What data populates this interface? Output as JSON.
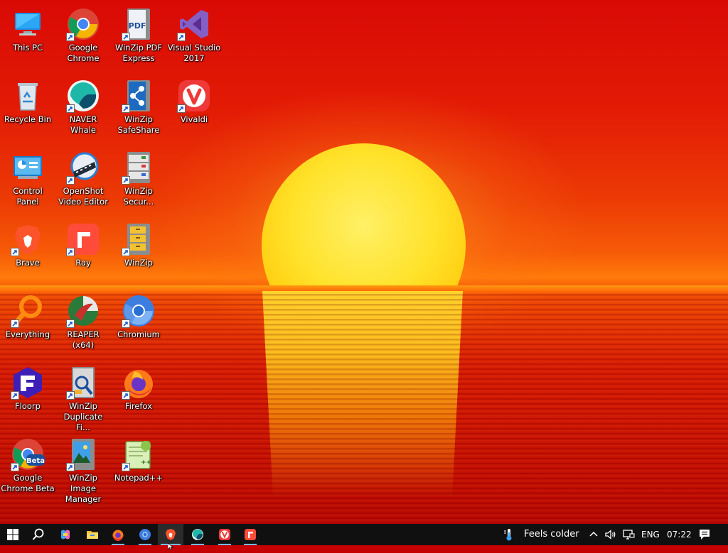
{
  "desktop_icons": [
    {
      "label": "This PC",
      "icon": "this-pc-icon"
    },
    {
      "label": "Google Chrome",
      "icon": "chrome-icon"
    },
    {
      "label": "WinZip PDF Express",
      "icon": "winzip-pdf-icon"
    },
    {
      "label": "Visual Studio 2017",
      "icon": "visual-studio-icon"
    },
    {
      "label": "Recycle Bin",
      "icon": "recycle-bin-icon"
    },
    {
      "label": "NAVER Whale",
      "icon": "naver-whale-icon"
    },
    {
      "label": "WinZip SafeShare",
      "icon": "winzip-safeshare-icon"
    },
    {
      "label": "Vivaldi",
      "icon": "vivaldi-icon"
    },
    {
      "label": "Control Panel",
      "icon": "control-panel-icon"
    },
    {
      "label": "OpenShot Video Editor",
      "icon": "openshot-icon"
    },
    {
      "label": "WinZip Secur...",
      "icon": "winzip-secure-icon"
    },
    {
      "label": "Brave",
      "icon": "brave-icon"
    },
    {
      "label": "Ray",
      "icon": "ray-icon"
    },
    {
      "label": "WinZip",
      "icon": "winzip-icon"
    },
    {
      "label": "Everything",
      "icon": "everything-icon"
    },
    {
      "label": "REAPER (x64)",
      "icon": "reaper-icon"
    },
    {
      "label": "Chromium",
      "icon": "chromium-icon"
    },
    {
      "label": "Floorp",
      "icon": "floorp-icon"
    },
    {
      "label": "WinZip Duplicate Fi...",
      "icon": "winzip-duplicate-icon"
    },
    {
      "label": "Firefox",
      "icon": "firefox-icon"
    },
    {
      "label": "Google Chrome Beta",
      "icon": "chrome-beta-icon"
    },
    {
      "label": "WinZip Image Manager",
      "icon": "winzip-image-icon"
    },
    {
      "label": "Notepad++",
      "icon": "notepad-plus-plus-icon"
    }
  ],
  "taskbar": {
    "start_icon": "windows-start-icon",
    "search_icon": "search-icon",
    "pinned": [
      "copilot-icon",
      "file-explorer-icon",
      "firefox-icon",
      "chromium-icon",
      "brave-icon",
      "naver-whale-icon",
      "vivaldi-icon",
      "ray-icon"
    ],
    "weather_text": "Feels colder",
    "language": "ENG",
    "time": "07:22"
  },
  "colors": {
    "taskbar_bg": "#101010",
    "active_indicator": "#77b8f0",
    "sun": "#ffe22a",
    "sky": "#e21a05"
  }
}
